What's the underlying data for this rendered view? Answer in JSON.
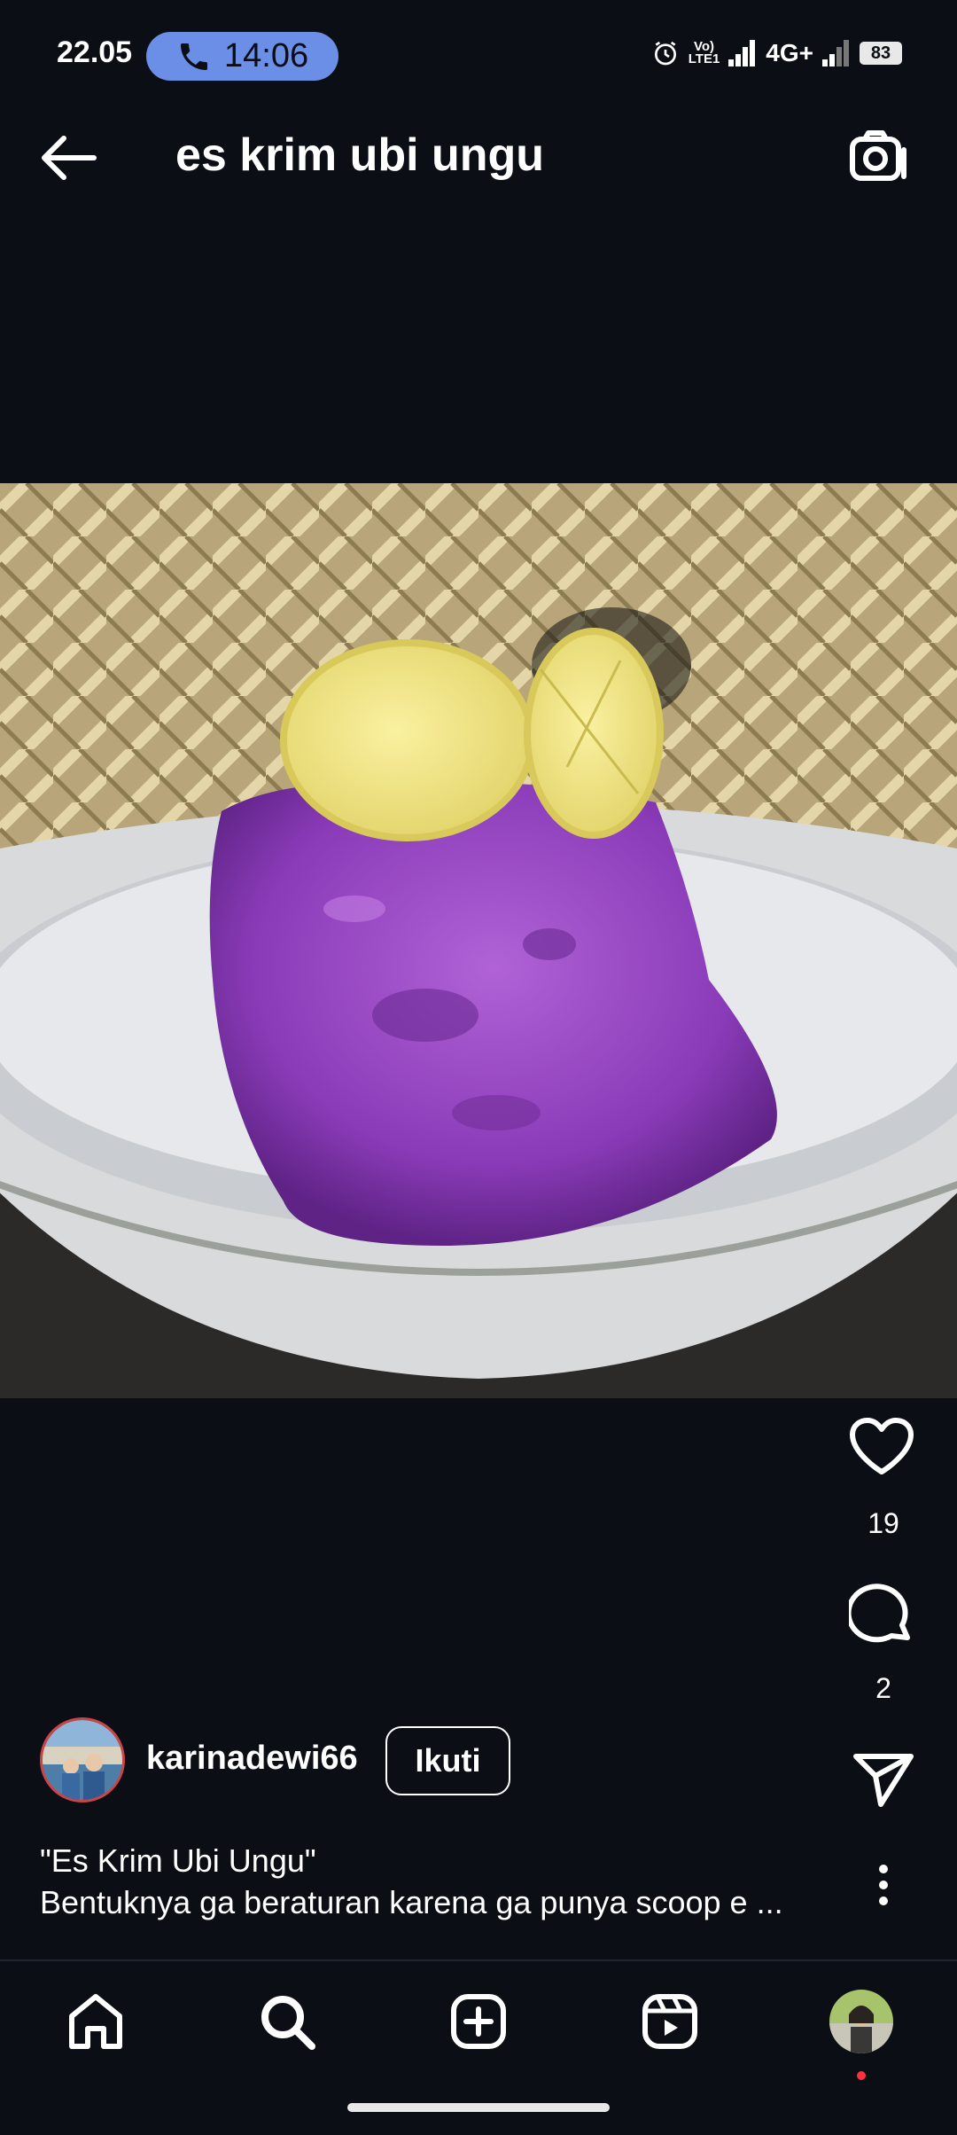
{
  "status_bar": {
    "time": "22.05",
    "call_duration": "14:06",
    "network": "4G+",
    "battery": "83"
  },
  "header": {
    "title": "es krim ubi ungu"
  },
  "post": {
    "likes": "19",
    "comments": "2",
    "username": "karinadewi66",
    "follow_label": "Ikuti",
    "caption_title": "\"Es Krim Ubi Ungu\"",
    "caption_body": "Bentuknya ga beraturan karena ga punya scoop e ..."
  },
  "icons": {
    "back": "arrow-left-icon",
    "camera": "camera-icon",
    "like": "heart-icon",
    "comment": "comment-icon",
    "share": "send-icon",
    "more": "more-vertical-icon",
    "nav_home": "home-icon",
    "nav_search": "search-icon",
    "nav_create": "plus-square-icon",
    "nav_reels": "reels-icon"
  },
  "colors": {
    "background": "#0b0e14",
    "call_pill": "#6b8fe6",
    "notification_dot": "#ff3040"
  }
}
